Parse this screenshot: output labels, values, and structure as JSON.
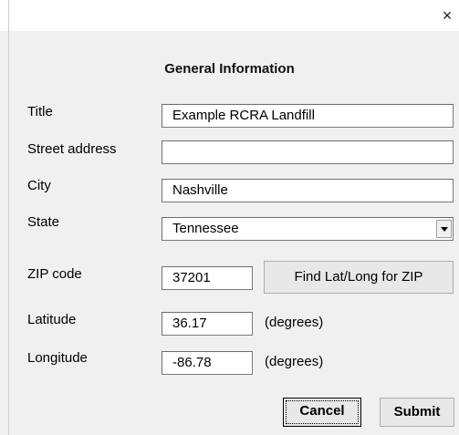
{
  "window": {
    "close_glyph": "×"
  },
  "form": {
    "heading": "General Information",
    "title_label": "Title",
    "title_value": "Example RCRA Landfill",
    "street_label": "Street address",
    "street_value": "",
    "city_label": "City",
    "city_value": "Nashville",
    "state_label": "State",
    "state_value": "Tennessee",
    "zip_label": "ZIP code",
    "zip_value": "37201",
    "find_button": "Find Lat/Long for ZIP",
    "latitude_label": "Latitude",
    "latitude_value": "36.17",
    "latitude_unit": "(degrees)",
    "longitude_label": "Longitude",
    "longitude_value": "-86.78",
    "longitude_unit": "(degrees)"
  },
  "buttons": {
    "cancel": "Cancel",
    "submit": "Submit"
  },
  "icons": {
    "close": "close-icon",
    "dropdown": "chevron-down-icon"
  }
}
